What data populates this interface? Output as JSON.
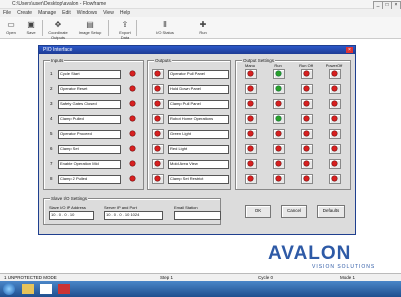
{
  "app": {
    "title": "C:\\Users\\user\\Desktop\\avalon - Flowframe",
    "menus": [
      "File",
      "Create",
      "Manage",
      "Edit",
      "Windows",
      "View",
      "Help"
    ]
  },
  "toolbar": {
    "buttons": [
      {
        "label": "Open",
        "icon": "open-icon"
      },
      {
        "label": "Save",
        "icon": "save-icon"
      },
      {
        "label": "Coordinate Outputs",
        "icon": "coordinate-icon"
      },
      {
        "label": "Image Setup",
        "icon": "image-setup-icon"
      },
      {
        "label": "Export Data",
        "icon": "export-icon"
      },
      {
        "label": "I/O Status",
        "icon": "io-status-icon"
      },
      {
        "label": "Run",
        "icon": "run-icon"
      }
    ]
  },
  "dialog": {
    "title": "PIO Interface",
    "inputs_label": "Inputs",
    "inputs": [
      {
        "num": "1",
        "value": "Cycle Start"
      },
      {
        "num": "2",
        "value": "Operator Reset"
      },
      {
        "num": "3",
        "value": "Safety Gates Closed"
      },
      {
        "num": "4",
        "value": "Clamp Pulled"
      },
      {
        "num": "5",
        "value": "Operator Proceed"
      },
      {
        "num": "6",
        "value": "Clamp Set"
      },
      {
        "num": "7",
        "value": "Enable Operation Mid"
      },
      {
        "num": "8",
        "value": "Clamp 2 Pulled"
      }
    ],
    "outputs_label": "Outputs",
    "outputs": [
      "Operator Pull Panel",
      "Hold Down Panel",
      "Clamp Pull Panel",
      "Robot Home Operations",
      "Green Light",
      "Red Light",
      "Mold Area View",
      "Clamp Set Restrict"
    ],
    "output_settings_label": "Output Settings",
    "output_columns": [
      "Manu",
      "Run",
      "Run Off",
      "PowerOff"
    ],
    "output_green_positions": [
      [
        0,
        1
      ],
      [
        1,
        1
      ],
      [
        3,
        1
      ]
    ],
    "settings_label": "Slave I/O Settings",
    "ip_label": "Slave I/O IP Address",
    "ip_value": "10  .  0  .  0  .  10",
    "server_label": "Server IP and Port",
    "server_value": "10  .  0  .  0  .  10   1024",
    "email_label": "Email Station",
    "email_value": "",
    "ok_label": "OK",
    "cancel_label": "Cancel",
    "default_label": "Defaults"
  },
  "statusbar": {
    "left": "1 UNPROTECTED MODE",
    "mid1": "Step 1",
    "mid2": "Cycle 0",
    "right": "Mode 1"
  },
  "logo": {
    "big": "AVALON",
    "small": "VISION SOLUTIONS"
  },
  "colors": {
    "led_red": "#d62020",
    "led_green": "#2aa02a",
    "title_blue": "#1d3b95",
    "brand": "#2e5aa6"
  }
}
